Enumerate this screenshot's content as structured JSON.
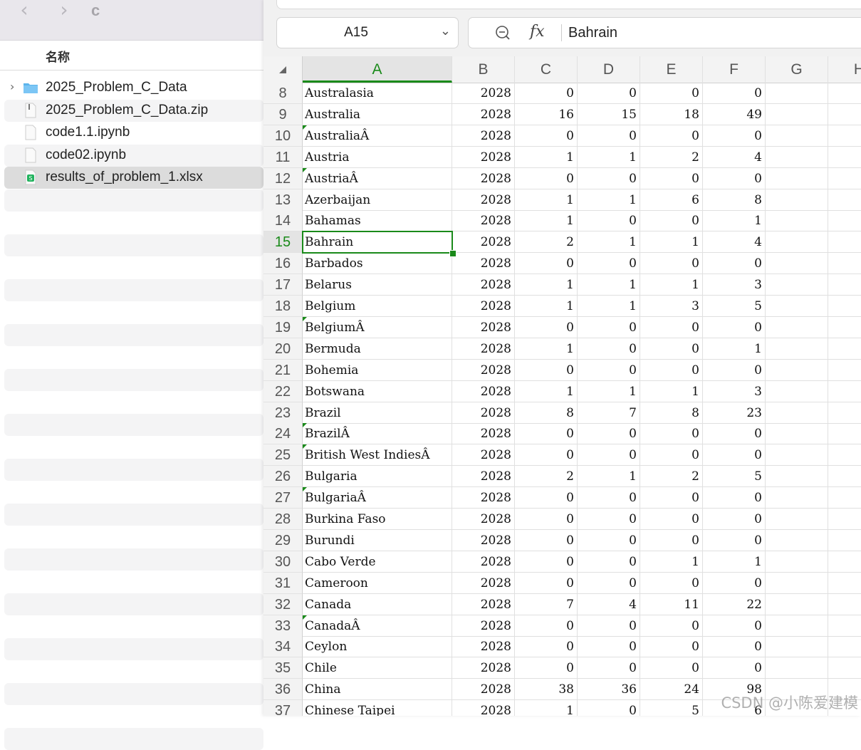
{
  "finder": {
    "title": "c",
    "back_icon": "‹",
    "forward_icon": "›",
    "column_header": "名称",
    "files": [
      {
        "name": "2025_Problem_C_Data",
        "kind": "folder",
        "disclosure": "›"
      },
      {
        "name": "2025_Problem_C_Data.zip",
        "kind": "zip"
      },
      {
        "name": "code1.1.ipynb",
        "kind": "document"
      },
      {
        "name": "code02.ipynb",
        "kind": "document"
      },
      {
        "name": "results_of_problem_1.xlsx",
        "kind": "spreadsheet",
        "selected": true
      }
    ]
  },
  "sheet": {
    "name_box": "A15",
    "name_box_chevron": "⌄",
    "formula_value": "Bahrain",
    "fx_label": "fx",
    "accent_color": "#1a8a1a",
    "columns": [
      "A",
      "B",
      "C",
      "D",
      "E",
      "F",
      "G",
      "H"
    ],
    "active_column": "A",
    "active_row": 15,
    "rows": [
      {
        "n": "8",
        "a": "Australasia",
        "b": "2028",
        "c": "0",
        "d": "0",
        "e": "0",
        "f": "0"
      },
      {
        "n": "9",
        "a": "Australia",
        "b": "2028",
        "c": "16",
        "d": "15",
        "e": "18",
        "f": "49"
      },
      {
        "n": "10",
        "a": "AustraliaÂ",
        "b": "2028",
        "c": "0",
        "d": "0",
        "e": "0",
        "f": "0",
        "flag": true
      },
      {
        "n": "11",
        "a": "Austria",
        "b": "2028",
        "c": "1",
        "d": "1",
        "e": "2",
        "f": "4"
      },
      {
        "n": "12",
        "a": "AustriaÂ",
        "b": "2028",
        "c": "0",
        "d": "0",
        "e": "0",
        "f": "0",
        "flag": true
      },
      {
        "n": "13",
        "a": "Azerbaijan",
        "b": "2028",
        "c": "1",
        "d": "1",
        "e": "6",
        "f": "8"
      },
      {
        "n": "14",
        "a": "Bahamas",
        "b": "2028",
        "c": "1",
        "d": "0",
        "e": "0",
        "f": "1"
      },
      {
        "n": "15",
        "a": "Bahrain",
        "b": "2028",
        "c": "2",
        "d": "1",
        "e": "1",
        "f": "4"
      },
      {
        "n": "16",
        "a": "Barbados",
        "b": "2028",
        "c": "0",
        "d": "0",
        "e": "0",
        "f": "0"
      },
      {
        "n": "17",
        "a": "Belarus",
        "b": "2028",
        "c": "1",
        "d": "1",
        "e": "1",
        "f": "3"
      },
      {
        "n": "18",
        "a": "Belgium",
        "b": "2028",
        "c": "1",
        "d": "1",
        "e": "3",
        "f": "5"
      },
      {
        "n": "19",
        "a": "BelgiumÂ",
        "b": "2028",
        "c": "0",
        "d": "0",
        "e": "0",
        "f": "0",
        "flag": true
      },
      {
        "n": "20",
        "a": "Bermuda",
        "b": "2028",
        "c": "1",
        "d": "0",
        "e": "0",
        "f": "1"
      },
      {
        "n": "21",
        "a": "Bohemia",
        "b": "2028",
        "c": "0",
        "d": "0",
        "e": "0",
        "f": "0"
      },
      {
        "n": "22",
        "a": "Botswana",
        "b": "2028",
        "c": "1",
        "d": "1",
        "e": "1",
        "f": "3"
      },
      {
        "n": "23",
        "a": "Brazil",
        "b": "2028",
        "c": "8",
        "d": "7",
        "e": "8",
        "f": "23"
      },
      {
        "n": "24",
        "a": "BrazilÂ",
        "b": "2028",
        "c": "0",
        "d": "0",
        "e": "0",
        "f": "0",
        "flag": true
      },
      {
        "n": "25",
        "a": "British West IndiesÂ",
        "b": "2028",
        "c": "0",
        "d": "0",
        "e": "0",
        "f": "0",
        "flag": true
      },
      {
        "n": "26",
        "a": "Bulgaria",
        "b": "2028",
        "c": "2",
        "d": "1",
        "e": "2",
        "f": "5"
      },
      {
        "n": "27",
        "a": "BulgariaÂ",
        "b": "2028",
        "c": "0",
        "d": "0",
        "e": "0",
        "f": "0",
        "flag": true
      },
      {
        "n": "28",
        "a": "Burkina Faso",
        "b": "2028",
        "c": "0",
        "d": "0",
        "e": "0",
        "f": "0"
      },
      {
        "n": "29",
        "a": "Burundi",
        "b": "2028",
        "c": "0",
        "d": "0",
        "e": "0",
        "f": "0"
      },
      {
        "n": "30",
        "a": "Cabo Verde",
        "b": "2028",
        "c": "0",
        "d": "0",
        "e": "1",
        "f": "1"
      },
      {
        "n": "31",
        "a": "Cameroon",
        "b": "2028",
        "c": "0",
        "d": "0",
        "e": "0",
        "f": "0"
      },
      {
        "n": "32",
        "a": "Canada",
        "b": "2028",
        "c": "7",
        "d": "4",
        "e": "11",
        "f": "22"
      },
      {
        "n": "33",
        "a": "CanadaÂ",
        "b": "2028",
        "c": "0",
        "d": "0",
        "e": "0",
        "f": "0",
        "flag": true
      },
      {
        "n": "34",
        "a": "Ceylon",
        "b": "2028",
        "c": "0",
        "d": "0",
        "e": "0",
        "f": "0"
      },
      {
        "n": "35",
        "a": "Chile",
        "b": "2028",
        "c": "0",
        "d": "0",
        "e": "0",
        "f": "0"
      },
      {
        "n": "36",
        "a": "China",
        "b": "2028",
        "c": "38",
        "d": "36",
        "e": "24",
        "f": "98"
      },
      {
        "n": "37",
        "a": "Chinese Taipei",
        "b": "2028",
        "c": "1",
        "d": "0",
        "e": "5",
        "f": "6"
      }
    ]
  },
  "watermark": "CSDN @小陈爱建模"
}
